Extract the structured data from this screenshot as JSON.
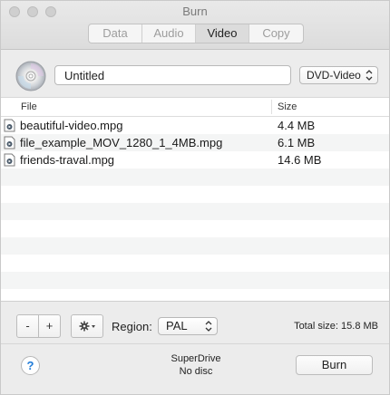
{
  "window": {
    "title": "Burn"
  },
  "tabs": [
    {
      "label": "Data",
      "active": false
    },
    {
      "label": "Audio",
      "active": false
    },
    {
      "label": "Video",
      "active": true
    },
    {
      "label": "Copy",
      "active": false
    }
  ],
  "disc": {
    "name_value": "Untitled",
    "type_selected": "DVD-Video"
  },
  "list": {
    "columns": {
      "file": "File",
      "size": "Size"
    },
    "files": [
      {
        "name": "beautiful-video.mpg",
        "size": "4.4 MB"
      },
      {
        "name": "file_example_MOV_1280_1_4MB.mpg",
        "size": "6.1 MB"
      },
      {
        "name": "friends-traval.mpg",
        "size": "14.6 MB"
      }
    ]
  },
  "toolbar": {
    "minus_label": "-",
    "plus_label": "+",
    "region_label": "Region:",
    "region_selected": "PAL",
    "total_size": "Total size: 15.8 MB"
  },
  "footer": {
    "help_label": "?",
    "drive_name": "SuperDrive",
    "drive_status": "No disc",
    "burn_label": "Burn"
  },
  "colors": {
    "help_accent": "#1f7bd8",
    "active_tab": "#dcdcdc",
    "row_alt": "#f4f5f5"
  },
  "icons": [
    "disc-icon",
    "file-video-icon",
    "gear-icon",
    "chevron-updown-icon",
    "help-icon"
  ]
}
